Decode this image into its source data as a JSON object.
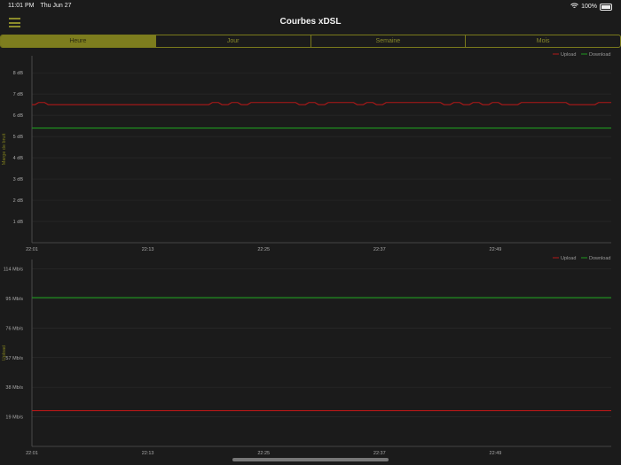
{
  "status_bar": {
    "time": "11:01 PM",
    "date": "Thu Jun 27",
    "battery": "100%",
    "icons": [
      "wifi-icon",
      "battery-icon"
    ]
  },
  "nav": {
    "title": "Courbes xDSL",
    "menu_icon": "hamburger-menu-icon"
  },
  "tabs": [
    {
      "label": "Heure",
      "selected": true
    },
    {
      "label": "Jour",
      "selected": false
    },
    {
      "label": "Semaine",
      "selected": false
    },
    {
      "label": "Mois",
      "selected": false
    }
  ],
  "colors": {
    "accent": "#7d7d1e",
    "upload": "#b01818",
    "download": "#1f9a1f"
  },
  "chart_data": [
    {
      "type": "line",
      "ylabel": "Marge de bruit",
      "y_ticks": [
        "1 dB",
        "2 dB",
        "3 dB",
        "4 dB",
        "5 dB",
        "6 dB",
        "7 dB",
        "8 dB"
      ],
      "ylim": [
        0,
        8.8
      ],
      "x_ticks": [
        "22:01",
        "22:13",
        "22:25",
        "22:37",
        "22:49"
      ],
      "x_range": [
        "22:01",
        "23:01"
      ],
      "x_interval_minutes": 1,
      "legend": "top-right",
      "grid": true,
      "series": [
        {
          "name": "Upload",
          "color": "#b01818",
          "values": [
            6.5,
            6.6,
            6.5,
            6.5,
            6.5,
            6.5,
            6.5,
            6.5,
            6.5,
            6.5,
            6.5,
            6.5,
            6.5,
            6.5,
            6.5,
            6.5,
            6.5,
            6.5,
            6.5,
            6.6,
            6.5,
            6.6,
            6.5,
            6.6,
            6.6,
            6.6,
            6.6,
            6.6,
            6.5,
            6.6,
            6.5,
            6.6,
            6.6,
            6.6,
            6.5,
            6.6,
            6.5,
            6.6,
            6.6,
            6.6,
            6.6,
            6.6,
            6.6,
            6.5,
            6.6,
            6.5,
            6.6,
            6.5,
            6.6,
            6.5,
            6.5,
            6.6,
            6.6,
            6.6,
            6.6,
            6.6,
            6.5,
            6.5,
            6.5,
            6.6,
            6.6
          ]
        },
        {
          "name": "Download",
          "color": "#1f9a1f",
          "values": [
            5.4,
            5.4
          ]
        }
      ]
    },
    {
      "type": "line",
      "ylabel": "Upload",
      "y_ticks": [
        "19 Mb/s",
        "38 Mb/s",
        "57 Mb/s",
        "76 Mb/s",
        "95 Mb/s",
        "114 Mb/s"
      ],
      "y_tick_values": [
        19,
        38,
        57,
        76,
        95,
        114
      ],
      "ylim": [
        0,
        120
      ],
      "x_ticks": [
        "22:01",
        "22:13",
        "22:25",
        "22:37",
        "22:49"
      ],
      "x_range": [
        "22:01",
        "23:01"
      ],
      "legend": "top-right",
      "grid": true,
      "series": [
        {
          "name": "Upload",
          "color": "#b01818",
          "values": [
            23,
            23
          ]
        },
        {
          "name": "Download",
          "color": "#1f9a1f",
          "values": [
            95.5,
            95.5
          ]
        }
      ]
    }
  ]
}
